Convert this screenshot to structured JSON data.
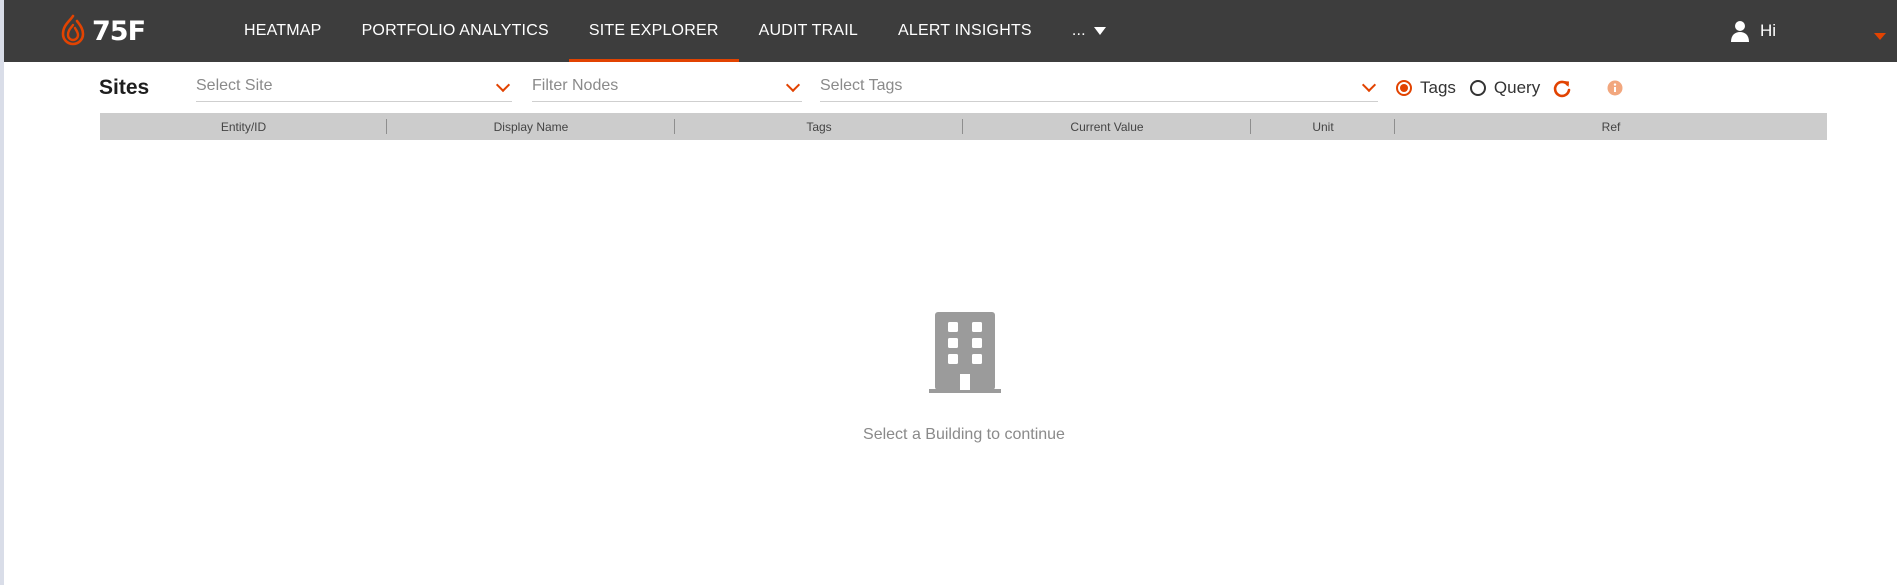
{
  "app": {
    "logo_text": "75F"
  },
  "nav": {
    "items": [
      {
        "label": "HEATMAP",
        "active": false
      },
      {
        "label": "PORTFOLIO ANALYTICS",
        "active": false
      },
      {
        "label": "SITE EXPLORER",
        "active": true
      },
      {
        "label": "AUDIT TRAIL",
        "active": false
      },
      {
        "label": "ALERT INSIGHTS",
        "active": false
      }
    ],
    "more_label": "..."
  },
  "user": {
    "greeting": "Hi",
    "icon": "user-icon"
  },
  "filters": {
    "title": "Sites",
    "site_placeholder": "Select Site",
    "nodes_placeholder": "Filter Nodes",
    "tags_placeholder": "Select Tags",
    "mode_options": [
      {
        "label": "Tags",
        "selected": true
      },
      {
        "label": "Query",
        "selected": false
      }
    ],
    "refresh_icon": "refresh-icon",
    "info_icon": "info-icon"
  },
  "table": {
    "columns": [
      "Entity/ID",
      "Display Name",
      "Tags",
      "Current Value",
      "Unit",
      "Ref"
    ]
  },
  "empty_state": {
    "icon": "building-icon",
    "message": "Select a Building to continue"
  },
  "colors": {
    "accent": "#e24301",
    "topbar": "#3d3d3d",
    "table_header": "#cccccc"
  }
}
